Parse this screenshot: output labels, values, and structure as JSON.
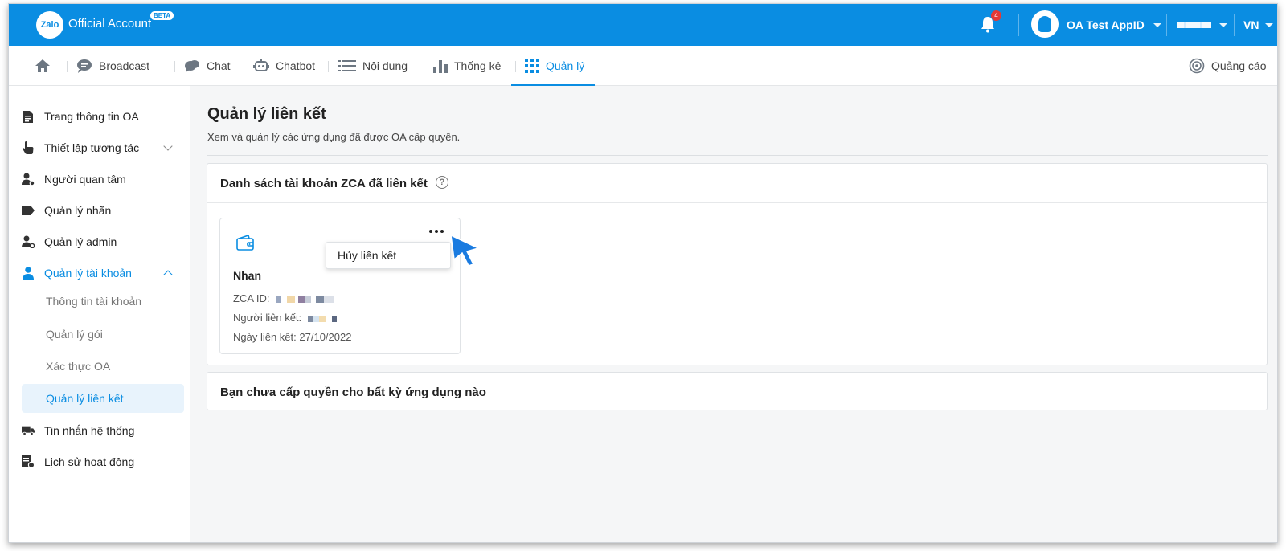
{
  "header": {
    "logo_text": "Zalo",
    "brand": "Official Account",
    "beta_badge": "BETA",
    "notification_count": "4",
    "account_name": "OA Test AppID",
    "language": "VN"
  },
  "nav": {
    "items": [
      {
        "label": "Broadcast",
        "icon": "chat-bubble-icon"
      },
      {
        "label": "Chat",
        "icon": "chat-icon"
      },
      {
        "label": "Chatbot",
        "icon": "robot-icon"
      },
      {
        "label": "Nội dung",
        "icon": "list-icon"
      },
      {
        "label": "Thống kê",
        "icon": "bar-chart-icon"
      },
      {
        "label": "Quản lý",
        "icon": "grid-icon"
      }
    ],
    "ads_label": "Quảng cáo",
    "active": "Quản lý"
  },
  "sidebar": {
    "items": [
      {
        "label": "Trang thông tin OA"
      },
      {
        "label": "Thiết lập tương tác"
      },
      {
        "label": "Người quan tâm"
      },
      {
        "label": "Quản lý nhãn"
      },
      {
        "label": "Quản lý admin"
      },
      {
        "label": "Quản lý tài khoản"
      },
      {
        "label": "Tin nhắn hệ thống"
      },
      {
        "label": "Lịch sử hoạt động"
      }
    ],
    "subitems": [
      {
        "label": "Thông tin tài khoản"
      },
      {
        "label": "Quản lý gói"
      },
      {
        "label": "Xác thực OA"
      },
      {
        "label": "Quản lý liên kết"
      }
    ]
  },
  "main": {
    "title": "Quản lý liên kết",
    "subtitle": "Xem và quản lý các ứng dụng đã được OA cấp quyền.",
    "zca_panel_title": "Danh sách tài khoản ZCA đã liên kết",
    "card": {
      "name": "Nhan",
      "zca_id_label": "ZCA ID:",
      "linker_label": "Người liên kết:",
      "date_label": "Ngày liên kết:",
      "date_value": "27/10/2022"
    },
    "menu_unlink": "Hủy liên kết",
    "apps_panel_title": "Bạn chưa cấp quyền cho bất kỳ ứng dụng nào"
  },
  "colors": {
    "brand_blue": "#0a8de2",
    "active_bg": "#e8f3fc",
    "badge_red": "#e53935"
  }
}
